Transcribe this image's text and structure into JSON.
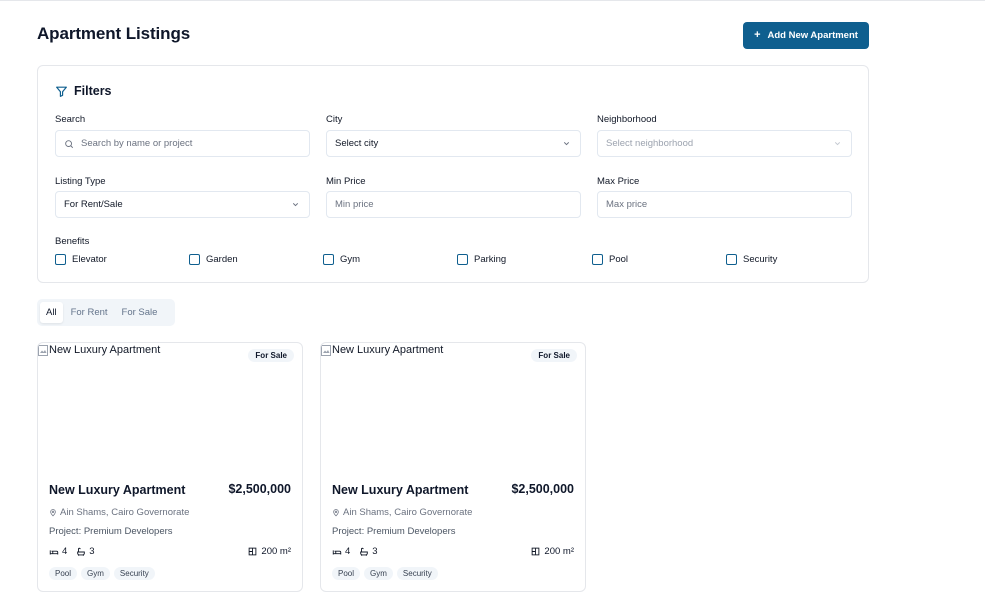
{
  "page": {
    "title": "Apartment Listings",
    "add_button": "Add New Apartment"
  },
  "filters": {
    "heading": "Filters",
    "search": {
      "label": "Search",
      "placeholder": "Search by name or project"
    },
    "city": {
      "label": "City",
      "value": "Select city"
    },
    "neighborhood": {
      "label": "Neighborhood",
      "placeholder": "Select neighborhood"
    },
    "listing_type": {
      "label": "Listing Type",
      "value": "For Rent/Sale"
    },
    "min_price": {
      "label": "Min Price",
      "placeholder": "Min price"
    },
    "max_price": {
      "label": "Max Price",
      "placeholder": "Max price"
    },
    "benefits_label": "Benefits",
    "benefits": [
      "Elevator",
      "Garden",
      "Gym",
      "Parking",
      "Pool",
      "Security"
    ]
  },
  "tabs": [
    "All",
    "For Rent",
    "For Sale"
  ],
  "listings": [
    {
      "image_alt": "New Luxury Apartment",
      "badge": "For Sale",
      "name": "New Luxury Apartment",
      "price": "$2,500,000",
      "location": "Ain Shams, Cairo Governorate",
      "project": "Project: Premium Developers",
      "bedrooms": "4",
      "bathrooms": "3",
      "area": "200 m²",
      "tags": [
        "Pool",
        "Gym",
        "Security"
      ]
    },
    {
      "image_alt": "New Luxury Apartment",
      "badge": "For Sale",
      "name": "New Luxury Apartment",
      "price": "$2,500,000",
      "location": "Ain Shams, Cairo Governorate",
      "project": "Project: Premium Developers",
      "bedrooms": "4",
      "bathrooms": "3",
      "area": "200 m²",
      "tags": [
        "Pool",
        "Gym",
        "Security"
      ]
    }
  ],
  "colors": {
    "primary": "#0f5f8f",
    "border": "#e5e7eb",
    "muted_bg": "#f1f5f9"
  }
}
